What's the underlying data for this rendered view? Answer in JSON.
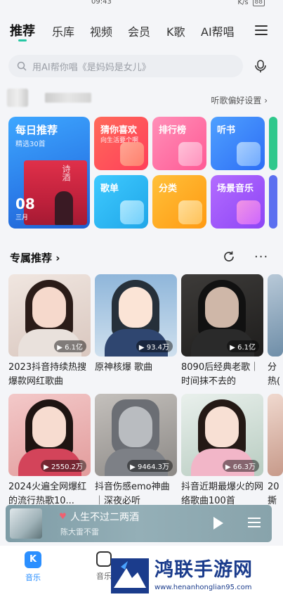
{
  "status": {
    "time": "09:43",
    "battery": "88",
    "net": "K/s"
  },
  "tabs": [
    {
      "label": "推荐",
      "active": true
    },
    {
      "label": "乐库"
    },
    {
      "label": "视频"
    },
    {
      "label": "会员"
    },
    {
      "label": "K歌"
    },
    {
      "label": "AI帮唱"
    }
  ],
  "search": {
    "placeholder": "用AI帮你唱《是妈妈是女儿》"
  },
  "user_row": {
    "preference_link": "听歌偏好设置 ›"
  },
  "daily": {
    "title": "每日推荐",
    "subtitle": "精选30首",
    "date": "08",
    "month": "三月",
    "art_text": "诗酒"
  },
  "features": [
    {
      "title": "猜你喜欢",
      "subtitle": "向生活要个啊",
      "color": "#ff5a55"
    },
    {
      "title": "排行榜",
      "subtitle": "",
      "color": "#ff72a6"
    },
    {
      "title": "听书",
      "subtitle": "",
      "color": "#3f8cff"
    },
    {
      "title": "歌单",
      "subtitle": "",
      "color": "#29bff0"
    },
    {
      "title": "分类",
      "subtitle": "",
      "color": "#ffab1f"
    },
    {
      "title": "场景音乐",
      "subtitle": "",
      "color": "#a35bff"
    }
  ],
  "section": {
    "title": "专属推荐 ›"
  },
  "cards": [
    {
      "title": "2023抖音持续热搜爆款网红歌曲",
      "plays": "▶ 6.1亿"
    },
    {
      "title": "原神核爆 歌曲",
      "plays": "▶ 93.4万"
    },
    {
      "title": "8090后经典老歌｜时间抹不去的",
      "plays": "▶ 6.1亿"
    },
    {
      "title": "2024火遍全网爆红的流行热歌10...",
      "plays": "▶ 2550.2万"
    },
    {
      "title": "抖音伤感emo神曲｜深夜必听",
      "plays": "▶ 9464.3万"
    },
    {
      "title": "抖音近期最爆火的网络歌曲100首",
      "plays": "▶ 66.3万"
    }
  ],
  "partial_cards": [
    {
      "title": "分\n热("
    },
    {
      "title": "20\n撕"
    }
  ],
  "player": {
    "song": "人生不过二两酒",
    "artist": "陈大雷不雷"
  },
  "nav": [
    {
      "label": "音乐",
      "icon": "K"
    },
    {
      "label": "音乐"
    }
  ],
  "watermark": {
    "text": "鸿联手游网",
    "url": "www.henanhonglian95.com"
  }
}
